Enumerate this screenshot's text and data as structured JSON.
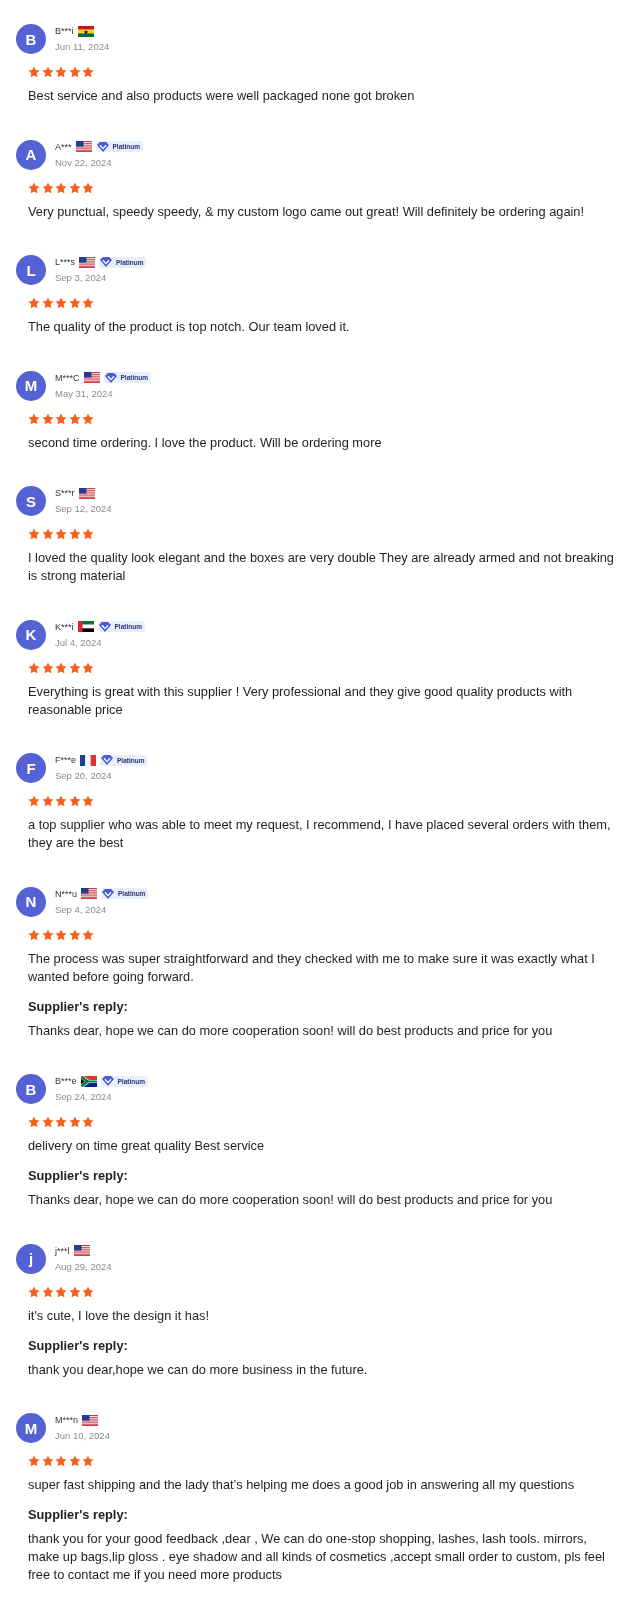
{
  "reviews": [
    {
      "avatar": "B",
      "name": "B***i",
      "flag": {
        "kind": "ghana"
      },
      "date": "Jun 11, 2024",
      "stars": 5,
      "text": "Best service and also products were well packaged none got broken"
    },
    {
      "avatar": "A",
      "name": "A***",
      "flag": {
        "kind": "usa"
      },
      "badge": "Platinum",
      "date": "Nov 22, 2024",
      "stars": 5,
      "text": "Very punctual, speedy speedy, & my custom logo came out great! Will definitely be ordering again!"
    },
    {
      "avatar": "L",
      "name": "L***s",
      "flag": {
        "kind": "usa"
      },
      "badge": "Platinum",
      "date": "Sep 3, 2024",
      "stars": 5,
      "text": "The quality of the product is top notch. Our team loved it."
    },
    {
      "avatar": "M",
      "name": "M***C",
      "flag": {
        "kind": "usa"
      },
      "badge": "Platinum",
      "date": "May 31, 2024",
      "stars": 5,
      "text": "second time ordering. I love the product. Will be ordering more"
    },
    {
      "avatar": "S",
      "name": "S***r",
      "flag": {
        "kind": "usa"
      },
      "date": "Sep 12, 2024",
      "stars": 5,
      "text": "I loved the quality look elegant and the boxes are very double They are already armed and not breaking is strong material"
    },
    {
      "avatar": "K",
      "name": "K***i",
      "flag": {
        "kind": "uae"
      },
      "badge": "Platinum",
      "date": "Jul 4, 2024",
      "stars": 5,
      "text": "Everything is great with this supplier ! Very professional and they give good quality products with reasonable price"
    },
    {
      "avatar": "F",
      "name": "F***e",
      "flag": {
        "kind": "france"
      },
      "badge": "Platinum",
      "date": "Sep 20, 2024",
      "stars": 5,
      "text": "a top supplier who was able to meet my request, I recommend, I have placed several orders with them, they are the best"
    },
    {
      "avatar": "N",
      "name": "N***u",
      "flag": {
        "kind": "usa"
      },
      "badge": "Platinum",
      "date": "Sep 4, 2024",
      "stars": 5,
      "text": "The process was super straightforward and they checked with me to make sure it was exactly what I wanted before going forward.",
      "reply": {
        "label": "Supplier's reply:",
        "text": "Thanks dear, hope we can do more cooperation soon! will do best products and price for you"
      }
    },
    {
      "avatar": "B",
      "name": "B***e",
      "flag": {
        "kind": "south-africa"
      },
      "badge": "Platinum",
      "date": "Sep 24, 2024",
      "stars": 5,
      "text": "delivery on time great quality Best service",
      "reply": {
        "label": "Supplier's reply:",
        "text": "Thanks dear, hope we can do more cooperation soon! will do best products and price for you"
      }
    },
    {
      "avatar": "j",
      "name": "j***l",
      "flag": {
        "kind": "usa"
      },
      "date": "Aug 29, 2024",
      "stars": 5,
      "text": "it's cute, I love the design it has!",
      "reply": {
        "label": "Supplier's reply:",
        "text": "thank you dear,hope we can do more business in the future."
      }
    },
    {
      "avatar": "M",
      "name": "M***n",
      "flag": {
        "kind": "usa"
      },
      "date": "Jun 10, 2024",
      "stars": 5,
      "text": "super fast shipping and the lady that’s helping me does a good job in answering all my questions",
      "reply": {
        "label": "Supplier's reply:",
        "text": "thank you for your good feedback ,dear , We can do one-stop shopping, lashes, lash tools. mirrors, make up bags,lip gloss . eye shadow and all kinds of cosmetics ,accept small order to custom, pls feel free to contact me if you need more products"
      }
    }
  ]
}
